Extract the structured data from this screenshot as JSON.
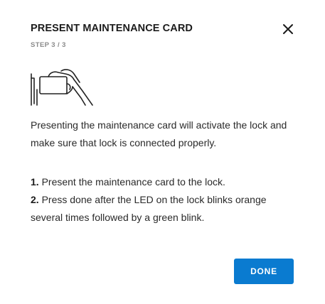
{
  "dialog": {
    "title": "PRESENT MAINTENANCE CARD",
    "step_indicator": "STEP 3 / 3",
    "close_icon": "close-icon",
    "illustration_icon": "hand-card-lock-icon",
    "description": "Presenting the maintenance card will activate the lock and make sure that lock is connected properly.",
    "steps": [
      {
        "number": "1.",
        "text": "Present the maintenance card to the lock."
      },
      {
        "number": "2.",
        "text": "Press done after the LED on the lock blinks orange several times followed by a green blink."
      }
    ],
    "done_label": "DONE"
  },
  "colors": {
    "accent": "#0a7bd0",
    "text": "#2a2a2a",
    "muted": "#8a8a8a",
    "background": "#ffffff"
  }
}
